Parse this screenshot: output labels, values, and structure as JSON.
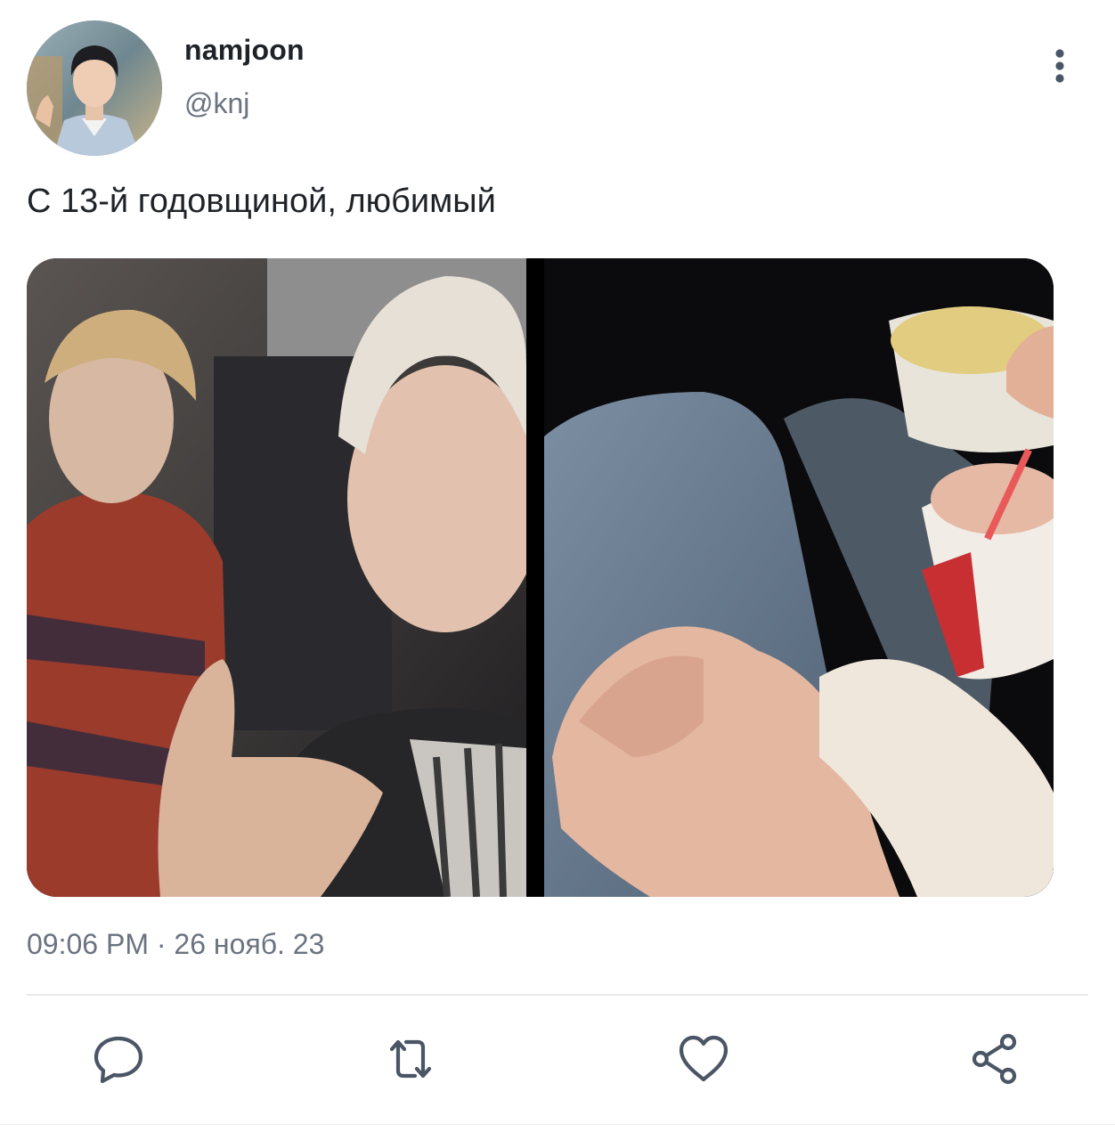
{
  "post": {
    "author": {
      "display_name": "namjoon",
      "handle": "@knj"
    },
    "text": "С 13-й годовщиной, любимый",
    "timestamp": "09:06 PM · 26 нояб. 23"
  },
  "icons": {
    "more": "more-vertical-icon",
    "reply": "comment-icon",
    "repost": "repost-icon",
    "like": "heart-icon",
    "share": "share-icon"
  },
  "colors": {
    "text_primary": "#1f2328",
    "text_secondary": "#6b7380",
    "icon": "#4a5566",
    "divider": "#e6e8eb"
  }
}
